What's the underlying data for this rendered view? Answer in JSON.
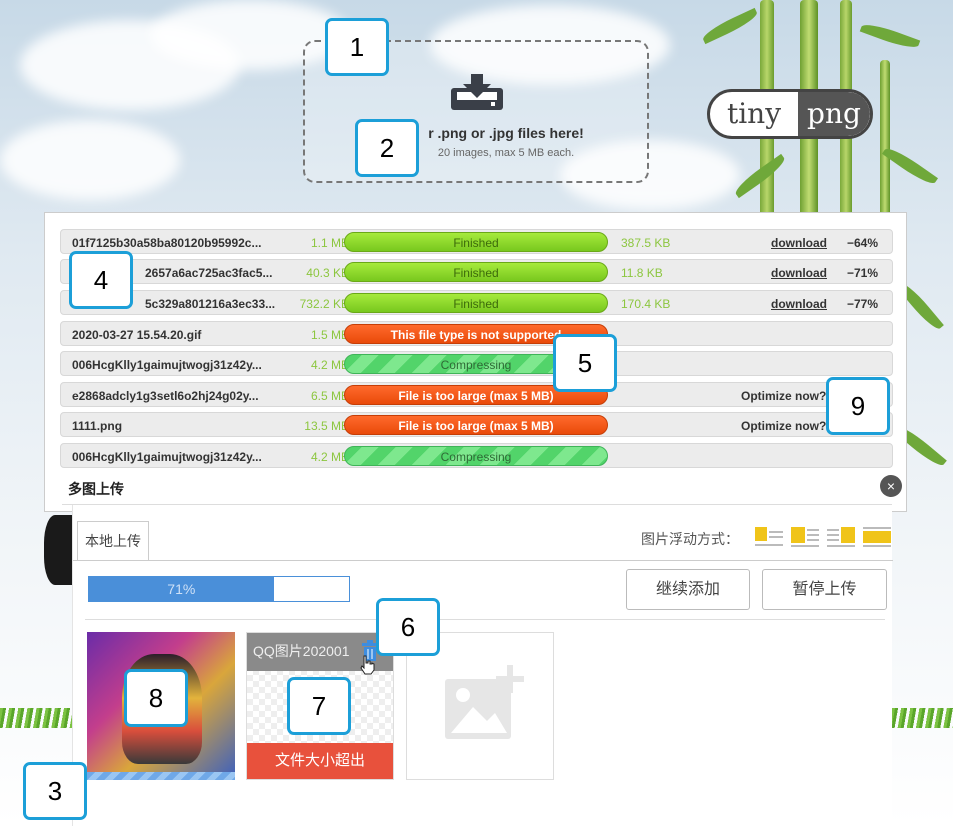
{
  "dropzone": {
    "title": "r .png or .jpg files here!",
    "subtitle": "20 images, max 5 MB each.",
    "icon": "download-tray-icon"
  },
  "logo": {
    "left": "tiny",
    "right": "png"
  },
  "results": [
    {
      "name": "01f7125b30a58ba80120b95992c...",
      "original": "1.1 MB",
      "status": "Finished",
      "state": "ok",
      "compressed": "387.5 KB",
      "download": "download",
      "saving": "−64%"
    },
    {
      "name": "2657a6ac725ac3fac5...",
      "original": "40.3 KB",
      "status": "Finished",
      "state": "ok",
      "compressed": "11.8 KB",
      "download": "download",
      "saving": "−71%"
    },
    {
      "name": "5c329a801216a3ec33...",
      "original": "732.2 KB",
      "status": "Finished",
      "state": "ok",
      "compressed": "170.4 KB",
      "download": "download",
      "saving": "−77%"
    },
    {
      "name": "2020-03-27 15.54.20.gif",
      "original": "1.5 MB",
      "status": "This file type is not supported",
      "state": "err"
    },
    {
      "name": "006HcgKlly1gaimujtwogj31z42y...",
      "original": "4.2 MB",
      "status": "Compressing",
      "state": "prog"
    },
    {
      "name": "e2868adcly1g3setl6o2hj24g02y...",
      "original": "6.5 MB",
      "status": "File is too large (max 5 MB)",
      "state": "err",
      "action": "Optimize now?"
    },
    {
      "name": "1111.png",
      "original": "13.5 MB",
      "status": "File is too large (max 5 MB)",
      "state": "err",
      "action": "Optimize now?"
    },
    {
      "name": "006HcgKlly1gaimujtwogj31z42y...",
      "original": "4.2 MB",
      "status": "Compressing",
      "state": "prog"
    }
  ],
  "dialog": {
    "title": "多图上传",
    "close": "×",
    "tab_local": "本地上传",
    "float_label": "图片浮动方式：",
    "progress_pct": 71,
    "progress_label": "71%",
    "btn_continue": "继续添加",
    "btn_pause": "暂停上传",
    "thumb2_caption": "QQ图片202001",
    "thumb2_error": "文件大小超出"
  },
  "callouts": [
    "1",
    "2",
    "3",
    "4",
    "5",
    "6",
    "7",
    "8",
    "9"
  ],
  "colors": {
    "accent": "#1c9fd8",
    "finished": "#8ad82c",
    "error": "#f05a14",
    "compressing": "#5ad470",
    "progress": "#4a8fd9",
    "size_green": "#8cc63f"
  }
}
